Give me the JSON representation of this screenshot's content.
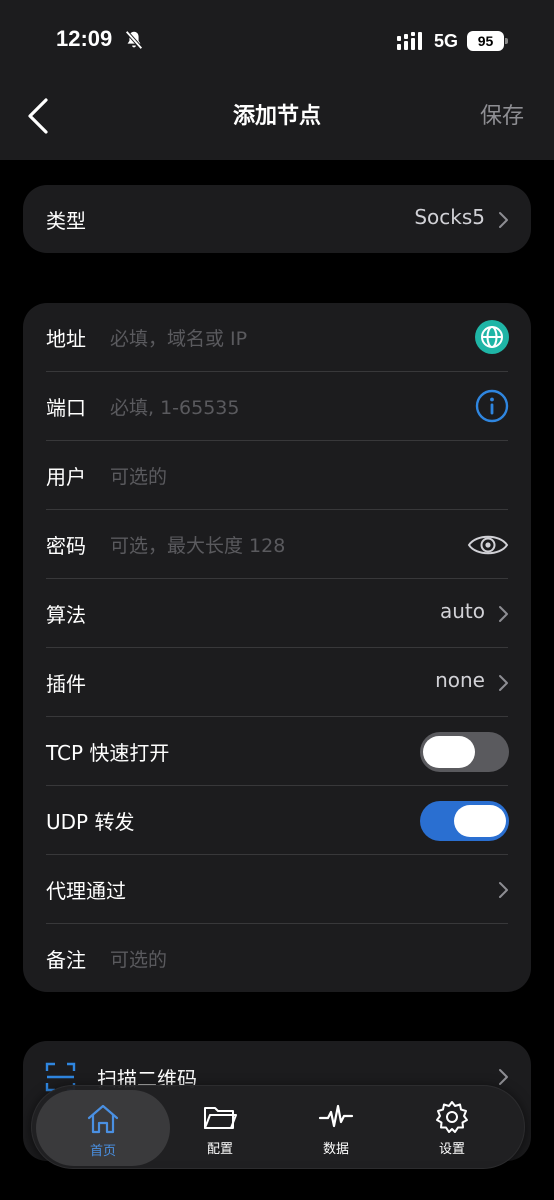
{
  "status_bar": {
    "time": "12:09",
    "network": "5G",
    "battery": "95"
  },
  "nav": {
    "title": "添加节点",
    "save_label": "保存"
  },
  "type_row": {
    "label": "类型",
    "value": "Socks5"
  },
  "form": {
    "address": {
      "label": "地址",
      "placeholder": "必填，域名或 IP"
    },
    "port": {
      "label": "端口",
      "placeholder": "必填, 1-65535"
    },
    "user": {
      "label": "用户",
      "placeholder": "可选的"
    },
    "password": {
      "label": "密码",
      "placeholder": "可选，最大长度 128"
    },
    "algorithm": {
      "label": "算法",
      "value": "auto"
    },
    "plugin": {
      "label": "插件",
      "value": "none"
    },
    "tcp_fast_open": {
      "label": "TCP 快速打开",
      "enabled": false
    },
    "udp_relay": {
      "label": "UDP 转发",
      "enabled": true
    },
    "proxy_via": {
      "label": "代理通过"
    },
    "note": {
      "label": "备注",
      "placeholder": "可选的"
    }
  },
  "qr": {
    "label": "扫描二维码"
  },
  "tabs": [
    {
      "label": "首页",
      "icon": "home-icon",
      "active": true
    },
    {
      "label": "配置",
      "icon": "folder-icon",
      "active": false
    },
    {
      "label": "数据",
      "icon": "pulse-icon",
      "active": false
    },
    {
      "label": "设置",
      "icon": "gear-icon",
      "active": false
    }
  ],
  "colors": {
    "accent": "#4a90e2",
    "toggle_on": "#2a6fd1",
    "globe": "#1fb5a6",
    "info": "#2f86e0"
  }
}
